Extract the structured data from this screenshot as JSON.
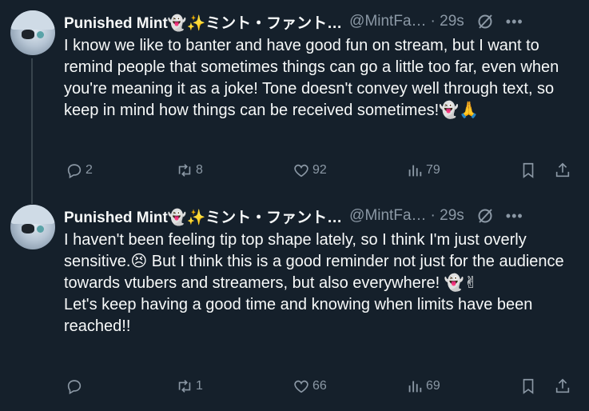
{
  "tweets": [
    {
      "author_name": "Punished Mint👻✨ミント・ファント…",
      "handle": "@MintFa…",
      "time": "· 29s",
      "text": "I know we like to banter and have good fun on stream, but I want to remind people that sometimes things can go a little too far, even when you're meaning it as a joke! Tone doesn't convey well through text, so keep in mind how things can be received sometimes!👻🙏",
      "replies": "2",
      "retweets": "8",
      "likes": "92",
      "views": "79"
    },
    {
      "author_name": "Punished Mint👻✨ミント・ファント…",
      "handle": "@MintFa…",
      "time": "· 29s",
      "text_para1": "I haven't been feeling tip top shape lately, so I think I'm just overly sensitive.😣 But I think this is a good reminder not just for the audience towards vtubers and streamers, but also everywhere! 👻✌",
      "text_para2": "Let's keep having a good time and knowing when limits have been reached!!",
      "replies": "",
      "retweets": "1",
      "likes": "66",
      "views": "69"
    }
  ],
  "icons": {
    "reply": "reply-icon",
    "retweet": "retweet-icon",
    "like": "heart-icon",
    "views": "views-icon",
    "bookmark": "bookmark-icon",
    "share": "share-icon",
    "grok": "grok-icon",
    "more": "more-icon"
  },
  "colors": {
    "background": "#15202b",
    "text_primary": "#f7f9f9",
    "text_secondary": "#8b98a5",
    "thread_line": "#38444d"
  }
}
